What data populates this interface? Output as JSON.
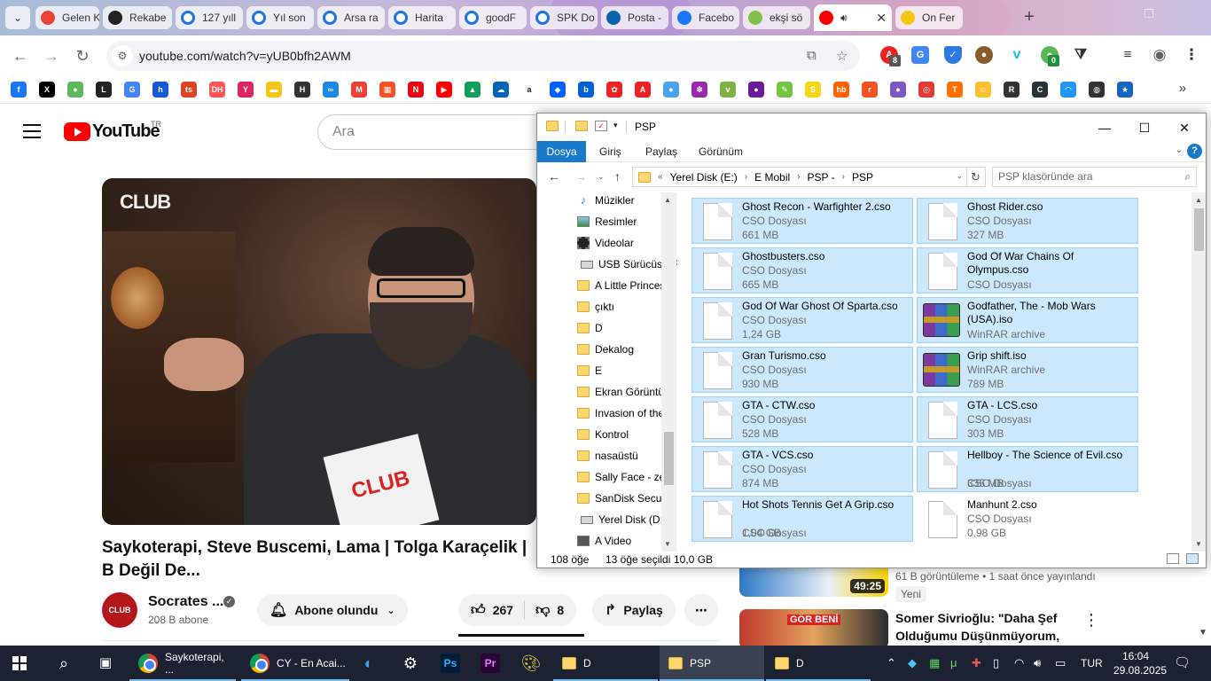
{
  "browser": {
    "tabs": [
      {
        "label": "Gelen K",
        "icon": "gmail-icon",
        "color": "#ea4335"
      },
      {
        "label": "Rekabe",
        "icon": "log-icon",
        "color": "#222222"
      },
      {
        "label": "127 yıll",
        "icon": "circle-o-icon",
        "color": "#1a73e8"
      },
      {
        "label": "Yıl son",
        "icon": "circle-o-icon",
        "color": "#1a73e8"
      },
      {
        "label": "Arsa ra",
        "icon": "circle-o-icon",
        "color": "#1a73e8"
      },
      {
        "label": "Harita",
        "icon": "circle-o-icon",
        "color": "#1a73e8"
      },
      {
        "label": "goodF",
        "icon": "circle-o-icon",
        "color": "#1a73e8"
      },
      {
        "label": "SPK Do",
        "icon": "circle-o-icon",
        "color": "#1a73e8"
      },
      {
        "label": "Posta -",
        "icon": "outlook-icon",
        "color": "#0a64ad"
      },
      {
        "label": "Facebo",
        "icon": "facebook-icon",
        "color": "#1877f2"
      },
      {
        "label": "ekşi sö",
        "icon": "eksi-icon",
        "color": "#81c14b"
      },
      {
        "label": "",
        "icon": "youtube-icon",
        "color": "#ff0000",
        "active": true
      },
      {
        "label": "On Fer",
        "icon": "imdb-icon",
        "color": "#f5c518"
      }
    ],
    "url": "youtube.com/watch?v=yUB0bfh2AWM",
    "extension_badges": {
      "abp": "8",
      "green": "0"
    }
  },
  "youtube": {
    "search_placeholder": "Ara",
    "logo_text": "YouTube",
    "country_code": "TR",
    "video_title": "Saykoterapi, Steve Buscemi, Lama | Tolga Karaçelik | B Değil De...",
    "thumbnail_brand": "CLUB",
    "channel_name": "Socrates ...",
    "channel_avatar": "CLUB",
    "subscribers": "208 B abone",
    "subscribe_label": "Abone olundu",
    "likes": "267",
    "dislikes": "8",
    "share_label": "Paylaş",
    "recommendations": [
      {
        "duration": "49:25",
        "meta": "61 B görüntüleme • 1 saat önce yayınlandı",
        "badge": "Yeni"
      },
      {
        "title": "Somer Sivrioğlu: \"Daha Şef Olduğumu Düşünmüyorum, ...",
        "thumb_text": "GÖR BENİ"
      }
    ]
  },
  "explorer": {
    "title": "PSP",
    "ribbon_tabs": [
      "Dosya",
      "Giriş",
      "Paylaş",
      "Görünüm"
    ],
    "breadcrumb": [
      "Yerel Disk (E:)",
      "E Mobil",
      "PSP -",
      "PSP"
    ],
    "search_placeholder": "PSP klasöründe ara",
    "tree": [
      {
        "label": "Müzikler",
        "icon": "music-icon"
      },
      {
        "label": "Resimler",
        "icon": "pictures-icon"
      },
      {
        "label": "Videolar",
        "icon": "videos-icon"
      },
      {
        "label": "USB Sürücüsü (F",
        "icon": "drive-icon"
      },
      {
        "label": "A Little Princes",
        "icon": "folder-icon"
      },
      {
        "label": "çıktı",
        "icon": "folder-icon"
      },
      {
        "label": "D",
        "icon": "folder-icon"
      },
      {
        "label": "Dekalog",
        "icon": "folder-icon"
      },
      {
        "label": "E",
        "icon": "folder-icon"
      },
      {
        "label": "Ekran Görüntül",
        "icon": "folder-icon"
      },
      {
        "label": "Invasion of the",
        "icon": "folder-icon"
      },
      {
        "label": "Kontrol",
        "icon": "folder-icon"
      },
      {
        "label": "nasaüstü",
        "icon": "folder-icon"
      },
      {
        "label": "Sally Face - zer",
        "icon": "folder-icon"
      },
      {
        "label": "SanDisk Secure",
        "icon": "folder-icon"
      },
      {
        "label": "Yerel Disk (D:)",
        "icon": "drive-icon"
      },
      {
        "label": "A Video",
        "icon": "video-folder-icon"
      }
    ],
    "files": [
      {
        "name": "Ghost Recon - Warfighter 2.cso",
        "type": "CSO Dosyası",
        "size": "661 MB",
        "icon": "document-icon",
        "selected": true
      },
      {
        "name": "Ghost Rider.cso",
        "type": "CSO Dosyası",
        "size": "327 MB",
        "icon": "document-icon",
        "selected": true
      },
      {
        "name": "Ghostbusters.cso",
        "type": "CSO Dosyası",
        "size": "665 MB",
        "icon": "document-icon",
        "selected": true
      },
      {
        "name": "God Of War Chains Of Olympus.cso",
        "type": "CSO Dosyası",
        "size": "",
        "icon": "document-icon",
        "selected": true
      },
      {
        "name": "God Of War Ghost Of Sparta.cso",
        "type": "CSO Dosyası",
        "size": "1,24 GB",
        "icon": "document-icon",
        "selected": true
      },
      {
        "name": "Godfather, The - Mob Wars (USA).iso",
        "type": "WinRAR archive",
        "size": "",
        "icon": "winrar-icon",
        "selected": true
      },
      {
        "name": "Gran Turismo.cso",
        "type": "CSO Dosyası",
        "size": "930 MB",
        "icon": "document-icon",
        "selected": true
      },
      {
        "name": "Grip shift.iso",
        "type": "WinRAR archive",
        "size": "789 MB",
        "icon": "winrar-icon",
        "selected": true
      },
      {
        "name": "GTA - CTW.cso",
        "type": "CSO Dosyası",
        "size": "528 MB",
        "icon": "document-icon",
        "selected": true
      },
      {
        "name": "GTA - LCS.cso",
        "type": "CSO Dosyası",
        "size": "303 MB",
        "icon": "document-icon",
        "selected": true
      },
      {
        "name": "GTA - VCS.cso",
        "type": "CSO Dosyası",
        "size": "874 MB",
        "icon": "document-icon",
        "selected": true
      },
      {
        "name": "Hellboy - The Science of Evil.cso",
        "type": "CSO Dosyası",
        "size": "335 MB",
        "icon": "document-icon",
        "selected": true
      },
      {
        "name": "Hot Shots Tennis Get A Grip.cso",
        "type": "CSO Dosyası",
        "size": "1,04 GB",
        "icon": "document-icon",
        "selected": true
      },
      {
        "name": "Manhunt 2.cso",
        "type": "CSO Dosyası",
        "size": "0,98 GB",
        "icon": "document-icon",
        "selected": false
      }
    ],
    "status": {
      "count": "108 öğe",
      "selected": "13 öğe seçildi",
      "size": "10,0 GB"
    }
  },
  "taskbar": {
    "apps": [
      {
        "label": "Saykoterapi, ...",
        "icon": "chrome-icon"
      },
      {
        "label": "CY - En Acai...",
        "icon": "chrome-icon"
      },
      {
        "label": "D",
        "icon": "folder-icon"
      },
      {
        "label": "PSP",
        "icon": "folder-icon",
        "active": true
      },
      {
        "label": "D",
        "icon": "folder-icon"
      }
    ],
    "language": "TUR",
    "time": "16:04",
    "date": "29.08.2025"
  }
}
